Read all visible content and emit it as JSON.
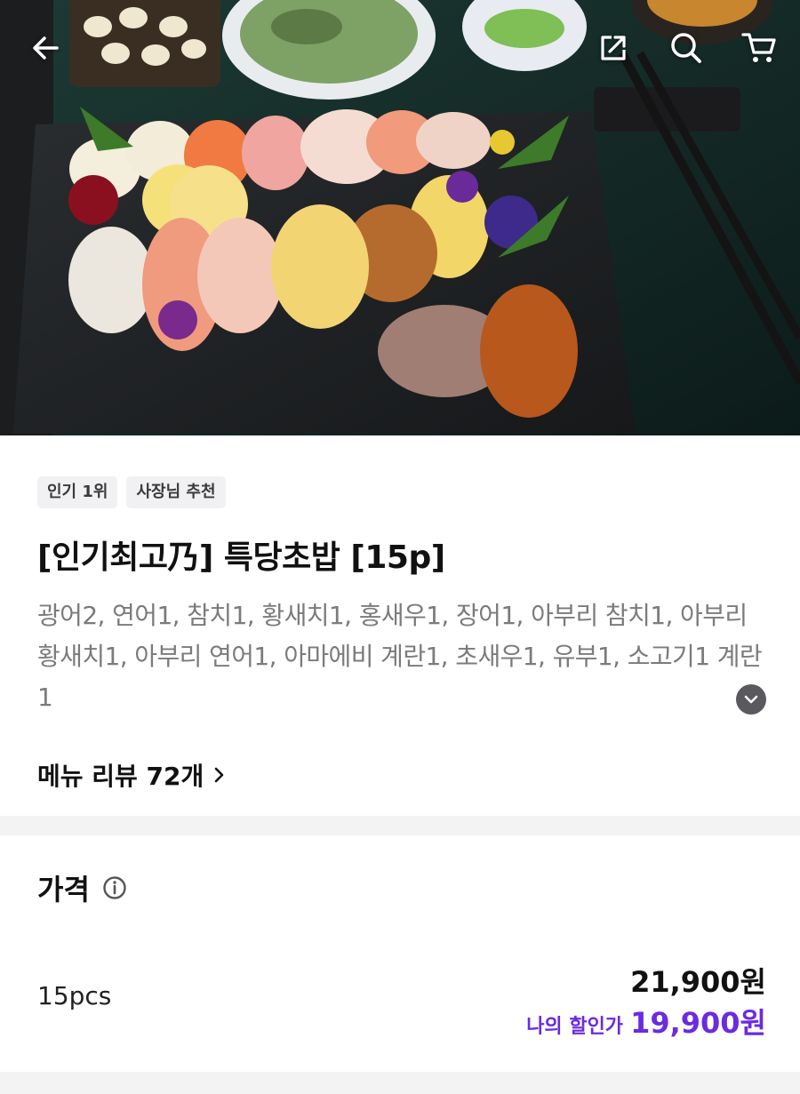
{
  "header": {
    "back_icon": "back-arrow-icon",
    "share_icon": "share-icon",
    "search_icon": "search-icon",
    "cart_icon": "cart-icon"
  },
  "menu": {
    "badges": [
      "인기 1위",
      "사장님 추천"
    ],
    "title": "[인기최고乃] 특당초밥 [15p]",
    "description": "광어2, 연어1, 참치1, 황새치1, 홍새우1, 장어1, 아부리 참치1, 아부리 황새치1, 아부리 연어1, 아마에비 계란1, 초새우1, 유부1, 소고기1 계란1",
    "review_link": "메뉴 리뷰 72개"
  },
  "price": {
    "title": "가격",
    "option_name": "15pcs",
    "original_price": "21,900원",
    "discount_label": "나의 할인가",
    "discount_price": "19,900원"
  },
  "colors": {
    "accent": "#6b2be0",
    "badge_bg": "#f1f1f3",
    "divider": "#f3f3f4"
  }
}
